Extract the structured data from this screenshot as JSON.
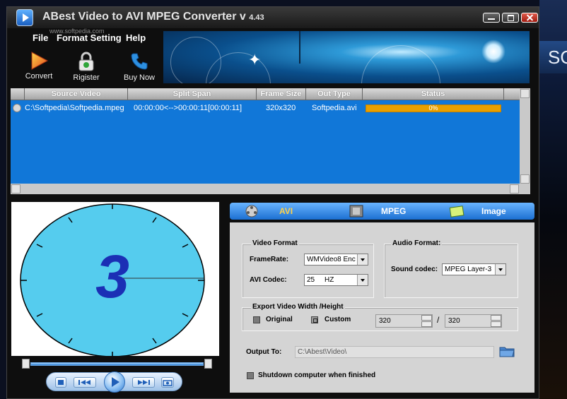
{
  "window": {
    "title": "ABest Video to AVI MPEG Converter v",
    "version": "4.43",
    "watermark": "www.softpedia.com"
  },
  "desktop": {
    "text": "SOF"
  },
  "menu": [
    "File",
    "Format Setting",
    "Help"
  ],
  "toolbar": {
    "convert": "Convert",
    "register": "Rigister",
    "buy": "Buy Now"
  },
  "table": {
    "columns": [
      "Source Video",
      "Split Span",
      "Frame Size",
      "Out Type",
      "Status"
    ],
    "rows": [
      {
        "source": "C:\\Softpedia\\Softpedia.mpeg",
        "span": "00:00:00<-->00:00:11[00:00:11]",
        "size": "320x320",
        "type": "Softpedia.avi",
        "status": "0%",
        "progress": 0
      }
    ]
  },
  "preview": {
    "digit": "3"
  },
  "tabs": {
    "avi": "AVI",
    "mpeg": "MPEG",
    "image": "Image"
  },
  "video_format": {
    "title": "Video Format",
    "framerate_label": "FrameRate:",
    "framerate_value": "WMVideo8 Enc",
    "codec_label": "AVI Codec:",
    "codec_value": "25     HZ"
  },
  "audio_format": {
    "title": "Audio Format:",
    "codec_label": "Sound codec:",
    "codec_value": "MPEG Layer-3"
  },
  "export": {
    "title": "Export Video Width /Height",
    "original": "Original",
    "custom": "Custom",
    "width": "320",
    "separator": "/",
    "height": "320"
  },
  "output": {
    "label": "Output To:",
    "path": "C:\\Abest\\Video\\"
  },
  "shutdown": "Shutdown computer when finished",
  "colors": {
    "accent": "#1177d8",
    "tab_active": "#ffd24a",
    "tab": "#ffffff",
    "progress": "#e9a000"
  }
}
